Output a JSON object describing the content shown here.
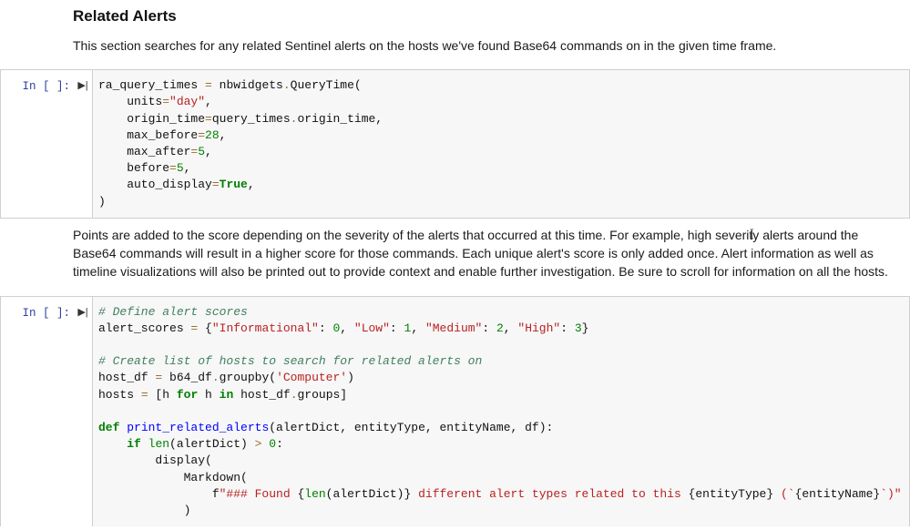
{
  "heading": "Related Alerts",
  "intro": "This section searches for any related Sentinel alerts on the hosts we've found Base64 commands on in the given time frame.",
  "middle_text": "Points are added to the score depending on the severity of the alerts that occurred at this time. For example, high severity alerts around the Base64 commands will result in a higher score for those commands. Each unique alert's score is only added once. Alert information as well as timeline visualizations will also be printed out to provide context and enable further investigation. Be sure to scroll for information on all the hosts.",
  "prompt_label": "In [ ]:",
  "run_glyph": "▶|",
  "code1": {
    "l1a": "ra_query_times ",
    "l1op": "=",
    "l1b": " nbwidgets",
    "l1dot": ".",
    "l1c": "QueryTime(",
    "l2a": "    units",
    "l2op": "=",
    "l2s": "\"day\"",
    "l2e": ",",
    "l3a": "    origin_time",
    "l3op": "=",
    "l3b": "query_times",
    "l3dot": ".",
    "l3c": "origin_time,",
    "l4a": "    max_before",
    "l4op": "=",
    "l4n": "28",
    "l4e": ",",
    "l5a": "    max_after",
    "l5op": "=",
    "l5n": "5",
    "l5e": ",",
    "l6a": "    before",
    "l6op": "=",
    "l6n": "5",
    "l6e": ",",
    "l7a": "    auto_display",
    "l7op": "=",
    "l7b": "True",
    "l7e": ",",
    "l8": ")"
  },
  "code2": {
    "c1": "# Define alert scores",
    "l2a": "alert_scores ",
    "l2op": "=",
    "l2b": " {",
    "l2s1": "\"Informational\"",
    "l2c": ": ",
    "l2n1": "0",
    "l2d": ", ",
    "l2s2": "\"Low\"",
    "l2e": ": ",
    "l2n2": "1",
    "l2f": ", ",
    "l2s3": "\"Medium\"",
    "l2g": ": ",
    "l2n3": "2",
    "l2h": ", ",
    "l2s4": "\"High\"",
    "l2i": ": ",
    "l2n4": "3",
    "l2j": "}",
    "c2": "# Create list of hosts to search for related alerts on",
    "l4a": "host_df ",
    "l4op": "=",
    "l4b": " b64_df",
    "l4dot": ".",
    "l4c": "groupby(",
    "l4s": "'Computer'",
    "l4e": ")",
    "l5a": "hosts ",
    "l5op": "=",
    "l5b": " [h ",
    "l5k1": "for",
    "l5c": " h ",
    "l5k2": "in",
    "l5d": " host_df",
    "l5dot": ".",
    "l5e": "groups]",
    "l7k": "def",
    "l7a": " ",
    "l7fn": "print_related_alerts",
    "l7b": "(alertDict, entityType, entityName, df):",
    "l8a": "    ",
    "l8k": "if",
    "l8b": " ",
    "l8len": "len",
    "l8c": "(alertDict) ",
    "l8op": ">",
    "l8d": " ",
    "l8n": "0",
    "l8e": ":",
    "l9": "        display(",
    "l10": "            Markdown(",
    "l11a": "                f",
    "l11s1": "\"### Found ",
    "l11b": "{",
    "l11len": "len",
    "l11c": "(alertDict)}",
    "l11s2": " different alert types related to this ",
    "l11d": "{entityType}",
    "l11s3": " (`",
    "l11e": "{entityName}",
    "l11s4": "`)\"",
    "l12": "            )"
  }
}
